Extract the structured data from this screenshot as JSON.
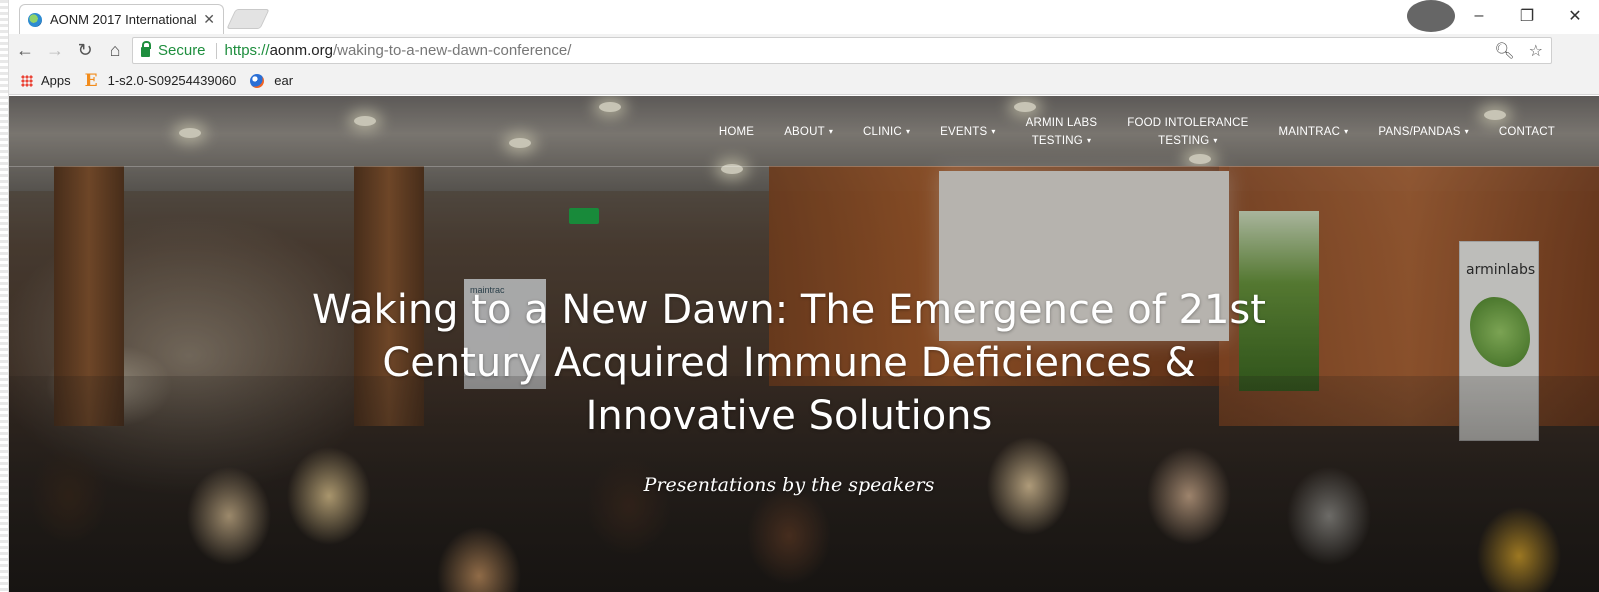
{
  "browser": {
    "tab": {
      "title": "AONM 2017 International"
    },
    "window_controls": {
      "minimize": "–",
      "restore": "❐",
      "close": "✕"
    },
    "address_bar": {
      "secure_label": "Secure",
      "url_scheme": "https://",
      "url_host": "aonm.org",
      "url_path": "/waking-to-a-new-dawn-conference/"
    },
    "bookmarks": [
      {
        "label": "Apps",
        "icon": "apps-grid-icon"
      },
      {
        "label": "1-s2.0-S09254439060",
        "icon": "elsevier-e-icon"
      },
      {
        "label": "ear",
        "icon": "firefox-globe-icon"
      }
    ]
  },
  "site": {
    "nav": [
      {
        "line1": "HOME",
        "line2": "",
        "caret": false
      },
      {
        "line1": "ABOUT",
        "line2": "",
        "caret": true
      },
      {
        "line1": "CLINIC",
        "line2": "",
        "caret": true
      },
      {
        "line1": "EVENTS",
        "line2": "",
        "caret": true
      },
      {
        "line1": "ARMIN LABS",
        "line2": "TESTING",
        "caret": true
      },
      {
        "line1": "FOOD INTOLERANCE",
        "line2": "TESTING",
        "caret": true
      },
      {
        "line1": "MAINTRAC",
        "line2": "",
        "caret": true
      },
      {
        "line1": "PANS/PANDAS",
        "line2": "",
        "caret": true
      },
      {
        "line1": "CONTACT",
        "line2": "",
        "caret": false
      }
    ],
    "hero": {
      "title_line1": "Waking to a New Dawn: The Emergence of 21st",
      "title_line2": "Century Acquired Immune Deficiences &",
      "title_line3": "Innovative Solutions",
      "subtitle": "Presentations by the speakers"
    },
    "photo_signs": {
      "maintrac": "maintrac",
      "armin": "arminlabs"
    }
  }
}
